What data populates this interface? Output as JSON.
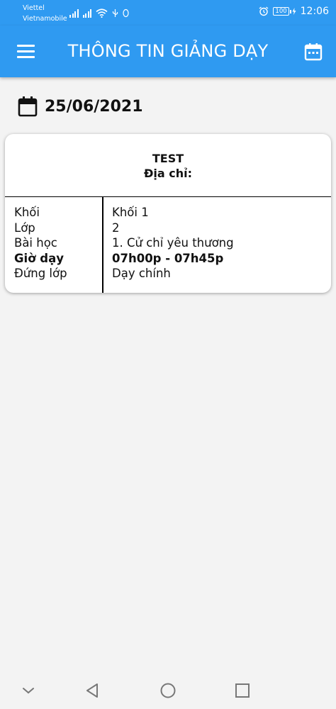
{
  "status_bar": {
    "carrier_1": "Viettel",
    "carrier_2": "Vietnamobile",
    "battery": "100",
    "time": "12:06"
  },
  "app_bar": {
    "title": "THÔNG TIN GIẢNG DẠY",
    "menu_icon": "hamburger-menu-icon",
    "calendar_icon": "calendar-icon"
  },
  "date": {
    "icon": "calendar-icon",
    "value": "25/06/2021"
  },
  "card": {
    "name": "TEST",
    "address_label": "Địa chỉ:",
    "rows": [
      {
        "label": "Khối",
        "value": "Khối 1"
      },
      {
        "label": "Lớp",
        "value": "2"
      },
      {
        "label": "Bài học",
        "value": "1. Cử chỉ yêu thương"
      },
      {
        "label": "Giờ dạy",
        "value": "07h00p - 07h45p"
      },
      {
        "label": "Đứng lớp",
        "value": "Dạy chính"
      }
    ]
  },
  "nav_bar": {
    "icons": [
      "chevron-down-icon",
      "back-triangle-icon",
      "home-circle-icon",
      "recents-square-icon"
    ]
  },
  "colors": {
    "primary": "#2f9af1",
    "background": "#f3f3f3"
  }
}
